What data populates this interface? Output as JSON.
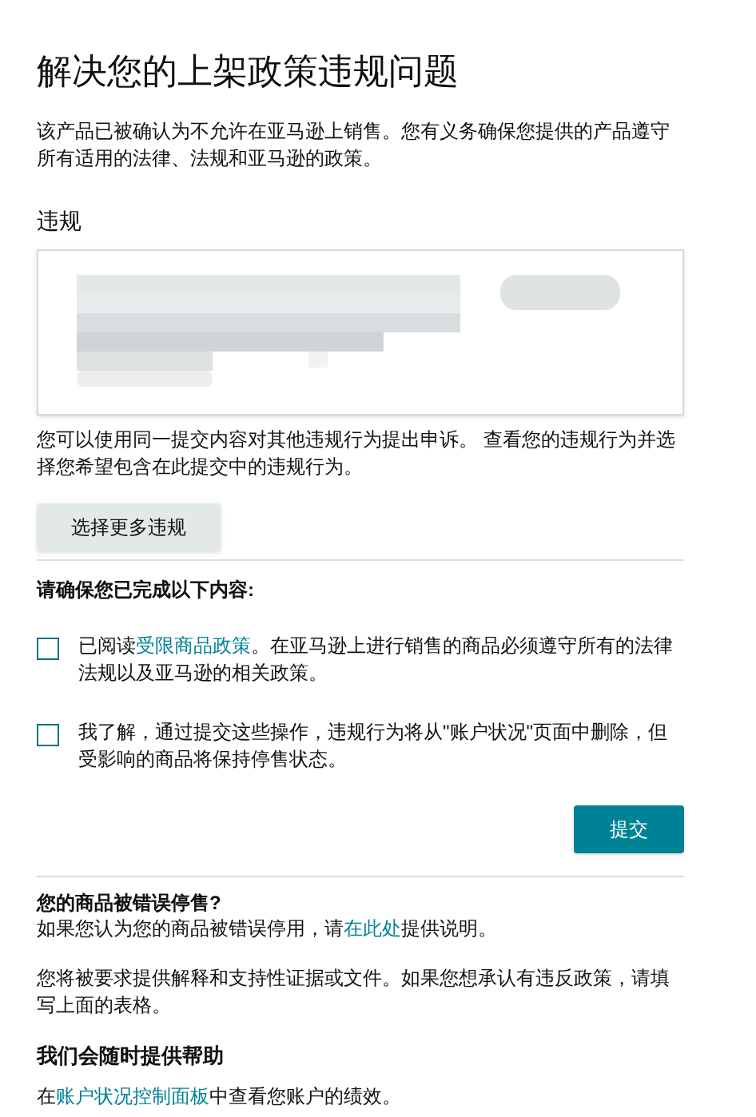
{
  "title": "解决您的上架政策违规问题",
  "intro": "该产品已被确认为不允许在亚马逊上销售。您有义务确保您提供的产品遵守所有适用的法律、法规和亚马逊的政策。",
  "violations": {
    "label": "违规"
  },
  "appeal_note": "您可以使用同一提交内容对其他违规行为提出申诉。 查看您的违规行为并选择您希望包含在此提交中的违规行为。",
  "select_button": "选择更多违规",
  "checklist": {
    "heading": "请确保您已完成以下内容:",
    "items": [
      {
        "checked": false,
        "parts": [
          {
            "text": "已阅读"
          },
          {
            "text": "受限商品政策",
            "link": true
          },
          {
            "text": "。在亚马逊上进行销售的商品必须遵守所有的法律法规以及亚马逊的相关政策。"
          }
        ]
      },
      {
        "checked": false,
        "parts": [
          {
            "text": "我了解，通过提交这些操作，违规行为将从\"账户状况\"页面中删除，但受影响的商品将保持停售状态。"
          }
        ]
      }
    ]
  },
  "submit_button": "提交",
  "footer": [
    {
      "kind": "heading",
      "parts": [
        {
          "text": "您的商品被错误停售?"
        }
      ]
    },
    {
      "kind": "text",
      "parts": [
        {
          "text": "如果您认为您的商品被错误停用，请"
        },
        {
          "text": "在此处",
          "link": true
        },
        {
          "text": "提供说明。"
        }
      ]
    },
    {
      "kind": "text",
      "parts": [
        {
          "text": "您将被要求提供解释和支持性证据或文件。如果您想承认有违反政策，请填写上面的表格。"
        }
      ]
    },
    {
      "kind": "title",
      "parts": [
        {
          "text": "我们会随时提供帮助"
        }
      ]
    },
    {
      "kind": "text",
      "parts": [
        {
          "text": "在"
        },
        {
          "text": "账户状况控制面板",
          "link": true
        },
        {
          "text": "中查看您账户的绩效。"
        }
      ]
    }
  ]
}
